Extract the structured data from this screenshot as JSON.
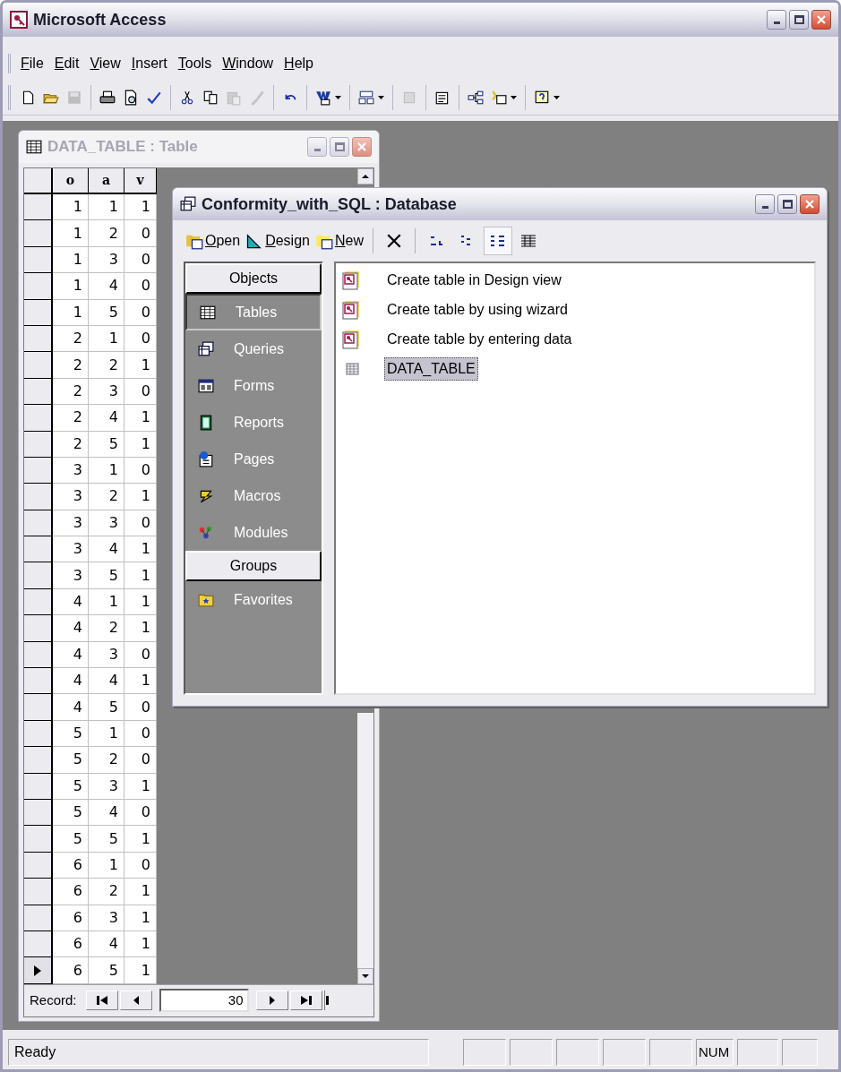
{
  "window": {
    "title": "Microsoft Access"
  },
  "menu": [
    "File",
    "Edit",
    "View",
    "Insert",
    "Tools",
    "Window",
    "Help"
  ],
  "toolbar": [
    {
      "kind": "button",
      "disabled": false,
      "dropdown": false
    },
    {
      "kind": "button",
      "disabled": false,
      "dropdown": false
    },
    {
      "kind": "button",
      "disabled": true,
      "dropdown": false
    },
    {
      "kind": "separator"
    },
    {
      "kind": "button",
      "disabled": false,
      "dropdown": false
    },
    {
      "kind": "button",
      "disabled": false,
      "dropdown": false
    },
    {
      "kind": "button",
      "disabled": false,
      "dropdown": false
    },
    {
      "kind": "separator"
    },
    {
      "kind": "button",
      "disabled": false,
      "dropdown": false
    },
    {
      "kind": "button",
      "disabled": false,
      "dropdown": false
    },
    {
      "kind": "button",
      "disabled": true,
      "dropdown": false
    },
    {
      "kind": "button",
      "disabled": true,
      "dropdown": false
    },
    {
      "kind": "separator"
    },
    {
      "kind": "button",
      "disabled": false,
      "dropdown": false
    },
    {
      "kind": "separator"
    },
    {
      "kind": "button",
      "disabled": false,
      "dropdown": true
    },
    {
      "kind": "separator"
    },
    {
      "kind": "button",
      "disabled": false,
      "dropdown": true
    },
    {
      "kind": "separator"
    },
    {
      "kind": "button",
      "disabled": true,
      "dropdown": false
    },
    {
      "kind": "separator"
    },
    {
      "kind": "button",
      "disabled": false,
      "dropdown": false
    },
    {
      "kind": "separator"
    },
    {
      "kind": "button",
      "disabled": false,
      "dropdown": false
    },
    {
      "kind": "button",
      "disabled": false,
      "dropdown": true
    },
    {
      "kind": "separator"
    },
    {
      "kind": "button",
      "disabled": false,
      "dropdown": true
    }
  ],
  "table_window": {
    "title": "DATA_TABLE : Table",
    "active": false,
    "columns": [
      "o",
      "a",
      "v"
    ],
    "rows": [
      {
        "cells": [
          "1",
          "1",
          "1"
        ],
        "current": false
      },
      {
        "cells": [
          "1",
          "2",
          "0"
        ],
        "current": false
      },
      {
        "cells": [
          "1",
          "3",
          "0"
        ],
        "current": false
      },
      {
        "cells": [
          "1",
          "4",
          "0"
        ],
        "current": false
      },
      {
        "cells": [
          "1",
          "5",
          "0"
        ],
        "current": false
      },
      {
        "cells": [
          "2",
          "1",
          "0"
        ],
        "current": false
      },
      {
        "cells": [
          "2",
          "2",
          "1"
        ],
        "current": false
      },
      {
        "cells": [
          "2",
          "3",
          "0"
        ],
        "current": false
      },
      {
        "cells": [
          "2",
          "4",
          "1"
        ],
        "current": false
      },
      {
        "cells": [
          "2",
          "5",
          "1"
        ],
        "current": false
      },
      {
        "cells": [
          "3",
          "1",
          "0"
        ],
        "current": false
      },
      {
        "cells": [
          "3",
          "2",
          "1"
        ],
        "current": false
      },
      {
        "cells": [
          "3",
          "3",
          "0"
        ],
        "current": false
      },
      {
        "cells": [
          "3",
          "4",
          "1"
        ],
        "current": false
      },
      {
        "cells": [
          "3",
          "5",
          "1"
        ],
        "current": false
      },
      {
        "cells": [
          "4",
          "1",
          "1"
        ],
        "current": false
      },
      {
        "cells": [
          "4",
          "2",
          "1"
        ],
        "current": false
      },
      {
        "cells": [
          "4",
          "3",
          "0"
        ],
        "current": false
      },
      {
        "cells": [
          "4",
          "4",
          "1"
        ],
        "current": false
      },
      {
        "cells": [
          "4",
          "5",
          "0"
        ],
        "current": false
      },
      {
        "cells": [
          "5",
          "1",
          "0"
        ],
        "current": false
      },
      {
        "cells": [
          "5",
          "2",
          "0"
        ],
        "current": false
      },
      {
        "cells": [
          "5",
          "3",
          "1"
        ],
        "current": false
      },
      {
        "cells": [
          "5",
          "4",
          "0"
        ],
        "current": false
      },
      {
        "cells": [
          "5",
          "5",
          "1"
        ],
        "current": false
      },
      {
        "cells": [
          "6",
          "1",
          "0"
        ],
        "current": false
      },
      {
        "cells": [
          "6",
          "2",
          "1"
        ],
        "current": false
      },
      {
        "cells": [
          "6",
          "3",
          "1"
        ],
        "current": false
      },
      {
        "cells": [
          "6",
          "4",
          "1"
        ],
        "current": false
      },
      {
        "cells": [
          "6",
          "5",
          "1"
        ],
        "current": true
      }
    ],
    "record_nav": {
      "label": "Record:",
      "value": "30"
    }
  },
  "database_window": {
    "title": "Conformity_with_SQL : Database",
    "active": true,
    "toolbar": [
      {
        "kind": "labeled",
        "label": "Open"
      },
      {
        "kind": "labeled",
        "label": "Design"
      },
      {
        "kind": "labeled",
        "label": "New"
      },
      {
        "kind": "separator"
      },
      {
        "kind": "delete"
      },
      {
        "kind": "separator"
      },
      {
        "kind": "view",
        "selected": false
      },
      {
        "kind": "view",
        "selected": false
      },
      {
        "kind": "view",
        "selected": true
      },
      {
        "kind": "view",
        "selected": false
      }
    ],
    "objects_header": "Objects",
    "objects": [
      {
        "label": "Tables",
        "selected": true
      },
      {
        "label": "Queries",
        "selected": false
      },
      {
        "label": "Forms",
        "selected": false
      },
      {
        "label": "Reports",
        "selected": false
      },
      {
        "label": "Pages",
        "selected": false
      },
      {
        "label": "Macros",
        "selected": false
      },
      {
        "label": "Modules",
        "selected": false
      }
    ],
    "groups_header": "Groups",
    "groups": [
      {
        "label": "Favorites",
        "selected": false
      }
    ],
    "items": [
      {
        "kind": "shortcut",
        "label": "Create table in Design view",
        "selected": false
      },
      {
        "kind": "shortcut",
        "label": "Create table by using wizard",
        "selected": false
      },
      {
        "kind": "shortcut",
        "label": "Create table by entering data",
        "selected": false
      },
      {
        "kind": "table",
        "label": "DATA_TABLE",
        "selected": true
      }
    ]
  },
  "status_bar": {
    "message": "Ready",
    "num_lock": "NUM"
  }
}
